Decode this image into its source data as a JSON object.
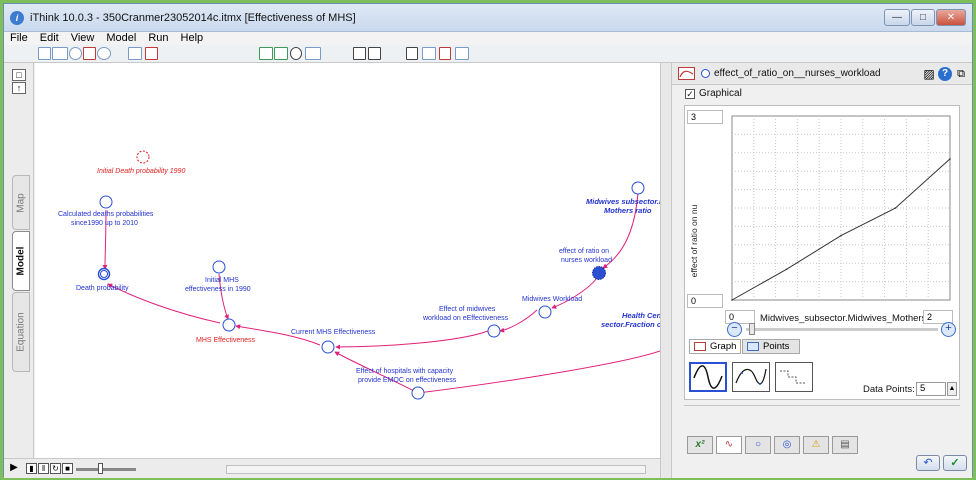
{
  "window": {
    "title": "iThink 10.0.3 - 350Cranmer23052014c.itmx [Effectiveness of MHS]",
    "app_icon": "ithink-icon",
    "controls": [
      "minimize-icon",
      "maximize-icon",
      "close-icon"
    ]
  },
  "menu": [
    "File",
    "Edit",
    "View",
    "Model",
    "Run",
    "Help"
  ],
  "side_tabs": [
    {
      "label": "Map",
      "active": false
    },
    {
      "label": "Model",
      "active": true
    },
    {
      "label": "Equation",
      "active": false
    }
  ],
  "model": {
    "labels": {
      "initial_death": "Initial Death probability 1990",
      "calc_deaths_1": "Calculated deaths probabilities",
      "calc_deaths_2": "since1990 up to 2010",
      "death_prob": "Death probability",
      "initial_mhs_1": "Initial MHS",
      "initial_mhs_2": "effectiveness  in 1990",
      "mhs_eff": "MHS Effectiveness",
      "current_mhs": "Current  MHS Effectiveness",
      "eff_midwives_1": "Effect of midwives",
      "eff_midwives_2": "workload on eEffectiveness",
      "midwives_workload": "Midwives Workload",
      "eff_ratio_1": "effect of ratio on",
      "eff_ratio_2": "nurses workload",
      "midwives_sub_1": "Midwives subsector.M",
      "midwives_sub_2": "Mothers ratio",
      "health_cen_1": "Health  Cen",
      "health_cen_2": "sector.Fraction of",
      "eff_hospitals_1": "Effect  of hospitals with capacity",
      "eff_hospitals_2": "provide EMOC on effectiveness"
    },
    "colors": {
      "link": "#e0207a",
      "node": "#2a4fd0",
      "ghost": "#e02020"
    }
  },
  "panel": {
    "variable_name": "effect_of_ratio_on__nurses_workload",
    "graphical_label": "Graphical",
    "graphical_checked": true,
    "y_max": "3",
    "y_min": "0",
    "y_axis_label": "effect of ratio on nu",
    "x_min": "0",
    "x_max": "2",
    "x_axis_label": "Midwives_subsector.Midwives_Mothers_ra",
    "tabs": {
      "graph": "Graph",
      "points": "Points"
    },
    "data_points_label": "Data Points:",
    "data_points_value": "5"
  },
  "chart_data": {
    "type": "line",
    "title": "",
    "xlabel": "Midwives_subsector.Midwives_Mothers_ra",
    "ylabel": "effect of ratio on nu",
    "xlim": [
      0,
      2
    ],
    "ylim": [
      0,
      3
    ],
    "grid": true,
    "series": [
      {
        "x": [
          0,
          0.5,
          1.0,
          1.5,
          2.0
        ],
        "y": [
          0.0,
          0.5,
          1.05,
          1.5,
          2.3
        ]
      }
    ]
  }
}
